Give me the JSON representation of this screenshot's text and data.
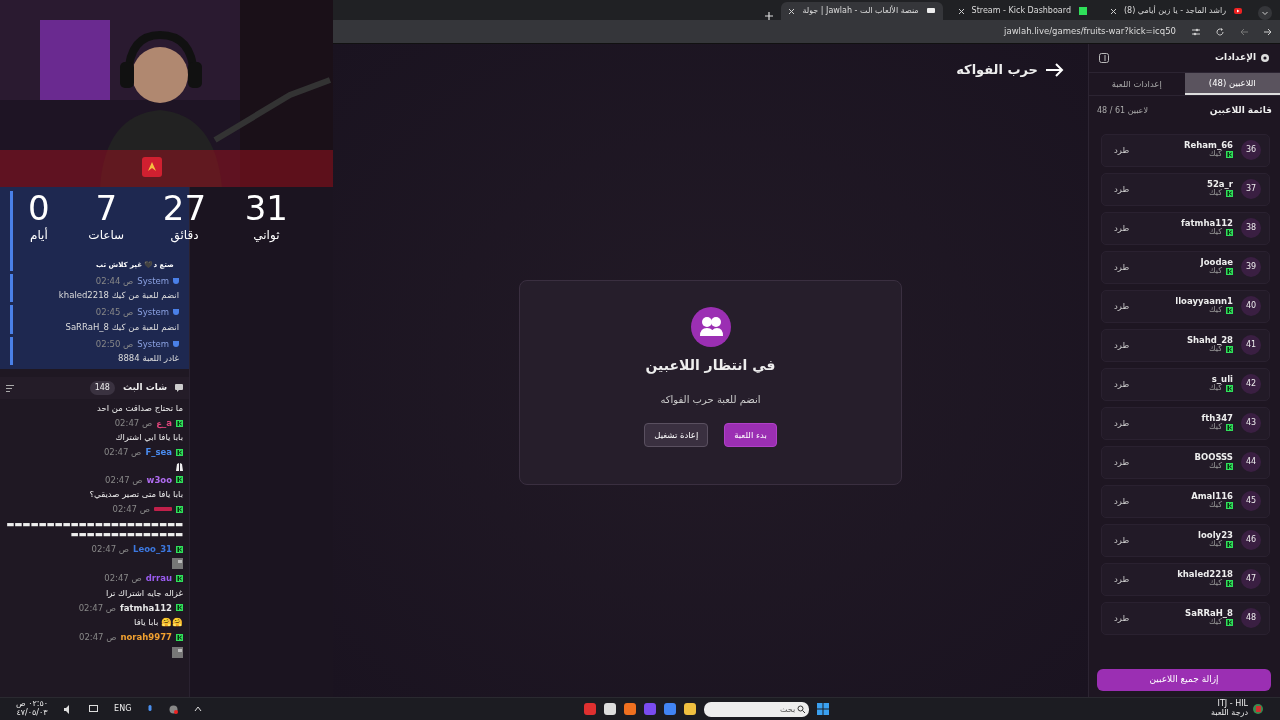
{
  "browser": {
    "tabs": [
      {
        "title": "(8) راشد الماجد - يا زين أيامي",
        "selected": false
      },
      {
        "title": "Stream - Kick Dashboard",
        "selected": false
      },
      {
        "title": "جولة | Jawlah - منصة الألعاب الت",
        "selected": true
      }
    ],
    "url": "jawlah.live/games/fruits-war?kick=icq50"
  },
  "countdown": [
    {
      "value": "31",
      "unit": "ثواني"
    },
    {
      "value": "27",
      "unit": "دقائق"
    },
    {
      "value": "7",
      "unit": "ساعات"
    },
    {
      "value": "0",
      "unit": "أيام"
    }
  ],
  "overlay_caption": "صتع د🖤 غير كلاش تب",
  "system_messages": [
    {
      "sender": "System",
      "time": "02:44 ص",
      "text": "khaled2218 انضم للعبة من كيك"
    },
    {
      "sender": "System",
      "time": "02:45 ص",
      "text": "SaRRaH_8 انضم للعبة من كيك"
    },
    {
      "sender": "System",
      "time": "02:50 ص",
      "text": "8884 غادر اللعبة"
    }
  ],
  "chat": {
    "title": "شات البث",
    "count": "148",
    "lead_text": "ما تحتاج صداقت من احد",
    "messages": [
      {
        "user": "ع_a",
        "time": "02:47 ص",
        "kind": "text",
        "text": "بابا يافا ابي اشتراك",
        "color": "#e0457b"
      },
      {
        "user": "F_sea",
        "time": "02:47 ص",
        "kind": "sticker",
        "color": "#4a8cf0"
      },
      {
        "user": "w3oo",
        "time": "02:47 ص",
        "kind": "text",
        "text": "بابا يافا متى تصير صديقي؟",
        "color": "#b06cf0"
      },
      {
        "time": "02:47 ص",
        "kind": "text",
        "text": "▬▬▬▬▬▬▬▬▬▬▬▬▬▬▬▬▬▬▬▬▬▬▬▬▬▬▬▬▬▬▬▬▬▬▬▬",
        "color": "#c0204a"
      },
      {
        "user": "Leoo_31",
        "time": "02:47 ص",
        "color": "#3c78e0"
      },
      {
        "user": "drrau",
        "time": "02:47 ص",
        "kind": "text",
        "text": "غزاله جايه اشتراك ترا",
        "color": "#9a5cf0"
      },
      {
        "user": "fatmha112",
        "time": "02:47 ص",
        "kind": "text",
        "text": "بابا يافا 🤗🤗",
        "color": "#e8e8e8"
      },
      {
        "user": "norah9977",
        "time": "02:47 ص",
        "color": "#f0a030"
      }
    ]
  },
  "game": {
    "title": "حرب الفواكه",
    "card_title": "في انتظار اللاعبين",
    "card_subtitle": "انضم للعبة حرب الفواكه",
    "buttons": [
      {
        "label": "بدء اللعبة",
        "kind": "primary"
      },
      {
        "label": "إعادة تشغيل",
        "kind": "secondary"
      }
    ]
  },
  "settings": {
    "title": "الإعدادات",
    "tabs": [
      {
        "label": "اللاعبين (48)",
        "selected": true
      },
      {
        "label": "إعدادات اللعبة",
        "selected": false
      }
    ],
    "list_title": "قائمة اللاعبين",
    "list_count": "48 / 61 لاعبين",
    "remove_all": "إزالة جميع اللاعبين",
    "players": [
      {
        "number": "36",
        "name": "Reham_66",
        "platform": "كيك",
        "kick": "طرد"
      },
      {
        "number": "37",
        "name": "52a_r",
        "platform": "كيك",
        "kick": "طرد"
      },
      {
        "number": "38",
        "name": "fatmha112",
        "platform": "كيك",
        "kick": "طرد"
      },
      {
        "number": "39",
        "name": "Joodae",
        "platform": "كيك",
        "kick": "طرد"
      },
      {
        "number": "40",
        "name": "lloayyaann1",
        "platform": "كيك",
        "kick": "طرد"
      },
      {
        "number": "41",
        "name": "Shahd_28",
        "platform": "كيك",
        "kick": "طرد"
      },
      {
        "number": "42",
        "name": "s_uli",
        "platform": "كيك",
        "kick": "طرد"
      },
      {
        "number": "43",
        "name": "fth347",
        "platform": "كيك",
        "kick": "طرد"
      },
      {
        "number": "44",
        "name": "BOOSSS",
        "platform": "كيك",
        "kick": "طرد"
      },
      {
        "number": "45",
        "name": "Amal116",
        "platform": "كيك",
        "kick": "طرد"
      },
      {
        "number": "46",
        "name": "looly23",
        "platform": "كيك",
        "kick": "طرد"
      },
      {
        "number": "47",
        "name": "khaled2218",
        "platform": "كيك",
        "kick": "طرد"
      },
      {
        "number": "48",
        "name": "SaRRaH_8",
        "platform": "كيك",
        "kick": "طرد"
      }
    ]
  },
  "taskbar": {
    "time": "٠٢:٥٠ ص",
    "date": "٤٧/٠٥/٠٣",
    "language": "ENG",
    "search_placeholder": "بحث",
    "widget_title": "ITJ - HIL",
    "widget_subtitle": "درجة اللعبة"
  }
}
